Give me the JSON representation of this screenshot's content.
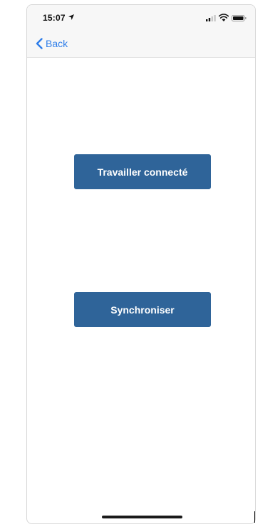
{
  "status_bar": {
    "time": "15:07",
    "icons": [
      "location-arrow-icon",
      "cellular-signal-icon",
      "wifi-icon",
      "battery-icon"
    ]
  },
  "nav": {
    "back_label": "Back",
    "back_icon": "chevron-left-icon"
  },
  "actions": {
    "connect_label": "Travailler connecté",
    "sync_label": "Synchroniser"
  },
  "colors": {
    "accent": "#2f7ee9",
    "button_bg": "#2f6499",
    "button_text": "#ffffff"
  }
}
